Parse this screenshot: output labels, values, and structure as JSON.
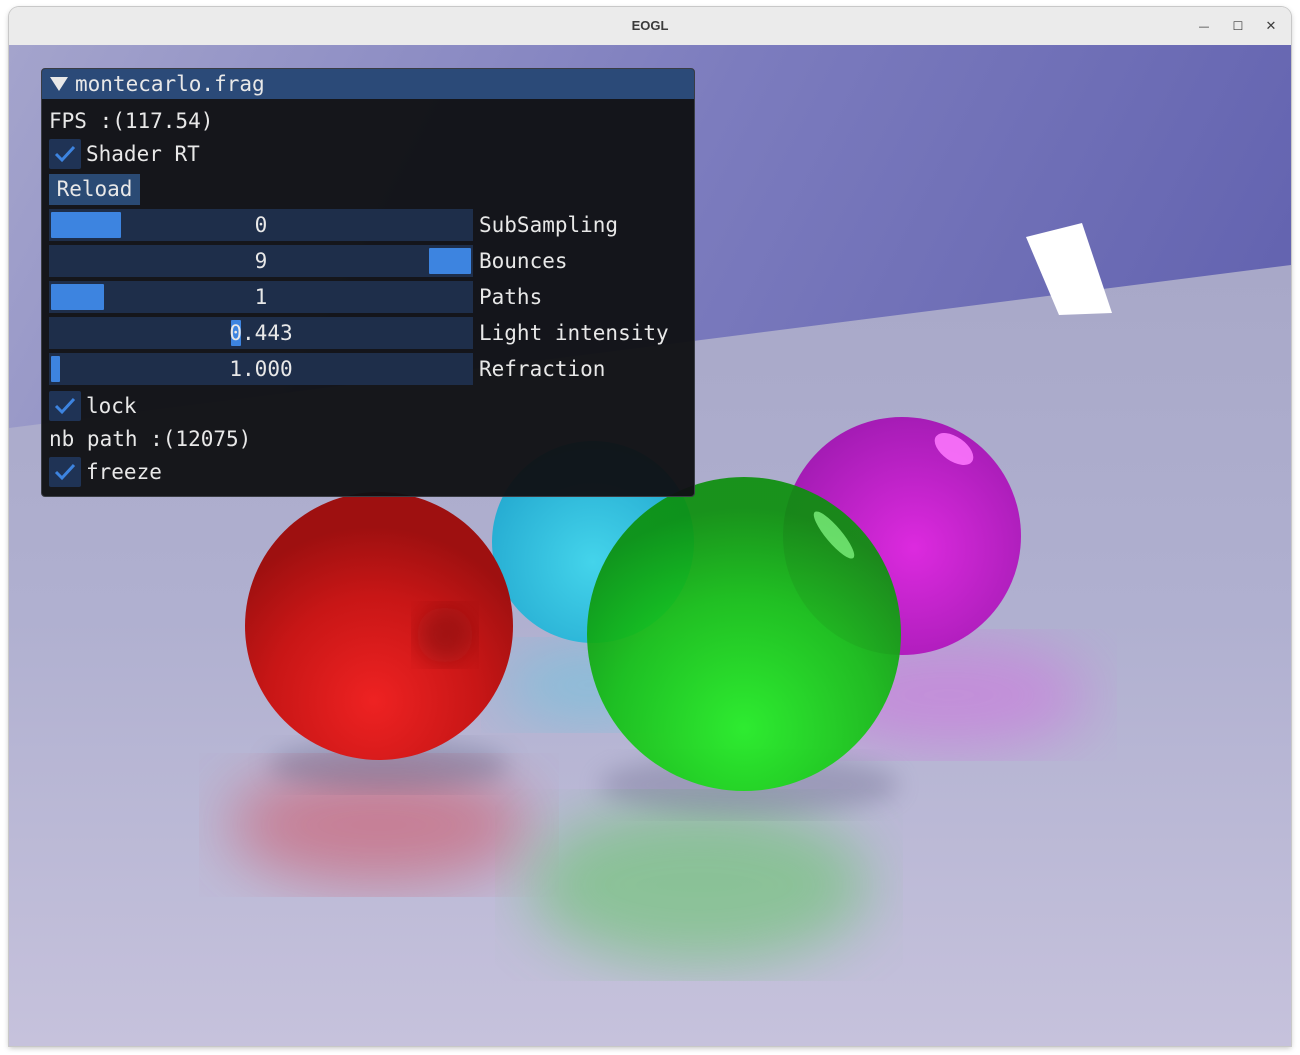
{
  "window": {
    "title": "EOGL",
    "minimize_glyph": "—",
    "maximize_glyph": "☐",
    "close_glyph": "✕"
  },
  "panel": {
    "title": "montecarlo.frag",
    "fps_text": "FPS :(117.54)",
    "shader_rt": {
      "label": "Shader RT",
      "checked": true
    },
    "reload_label": "Reload",
    "sliders": [
      {
        "label": "SubSampling",
        "value": "0",
        "fraction": 0.0
      },
      {
        "label": "Bounces",
        "value": "9",
        "fraction": 1.0
      },
      {
        "label": "Paths",
        "value": "1",
        "fraction": 0.0
      },
      {
        "label": "Light intensity",
        "value": "0.443",
        "fraction": 0.443
      },
      {
        "label": "Refraction",
        "value": "1.000",
        "fraction": 0.0
      }
    ],
    "lock": {
      "label": "lock",
      "checked": true
    },
    "nb_path_text": "nb path :(12075)",
    "freeze": {
      "label": "freeze",
      "checked": true
    }
  },
  "colors": {
    "accent": "#3d84e0",
    "header": "#2b4a78",
    "frame_bg": "#1e2e4a",
    "sphere_red": "#d21a1a",
    "sphere_cyan": "#1ec8e6",
    "sphere_green": "#14c814",
    "sphere_magenta": "#c814c8",
    "wall": "#6e6eb4",
    "floor": "#b4b4d4"
  }
}
